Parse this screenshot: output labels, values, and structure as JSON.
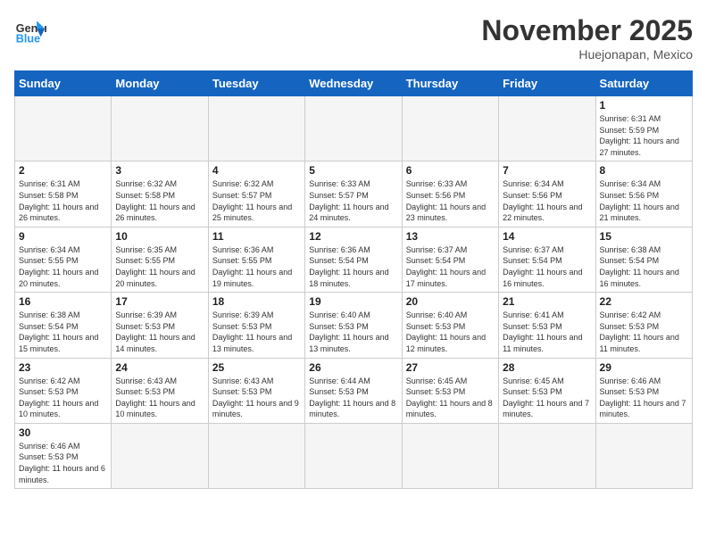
{
  "header": {
    "logo_general": "General",
    "logo_blue": "Blue",
    "month_title": "November 2025",
    "location": "Huejonapan, Mexico"
  },
  "weekdays": [
    "Sunday",
    "Monday",
    "Tuesday",
    "Wednesday",
    "Thursday",
    "Friday",
    "Saturday"
  ],
  "days": {
    "d1": {
      "num": "1",
      "sunrise": "Sunrise: 6:31 AM",
      "sunset": "Sunset: 5:59 PM",
      "daylight": "Daylight: 11 hours and 27 minutes."
    },
    "d2": {
      "num": "2",
      "sunrise": "Sunrise: 6:31 AM",
      "sunset": "Sunset: 5:58 PM",
      "daylight": "Daylight: 11 hours and 26 minutes."
    },
    "d3": {
      "num": "3",
      "sunrise": "Sunrise: 6:32 AM",
      "sunset": "Sunset: 5:58 PM",
      "daylight": "Daylight: 11 hours and 26 minutes."
    },
    "d4": {
      "num": "4",
      "sunrise": "Sunrise: 6:32 AM",
      "sunset": "Sunset: 5:57 PM",
      "daylight": "Daylight: 11 hours and 25 minutes."
    },
    "d5": {
      "num": "5",
      "sunrise": "Sunrise: 6:33 AM",
      "sunset": "Sunset: 5:57 PM",
      "daylight": "Daylight: 11 hours and 24 minutes."
    },
    "d6": {
      "num": "6",
      "sunrise": "Sunrise: 6:33 AM",
      "sunset": "Sunset: 5:56 PM",
      "daylight": "Daylight: 11 hours and 23 minutes."
    },
    "d7": {
      "num": "7",
      "sunrise": "Sunrise: 6:34 AM",
      "sunset": "Sunset: 5:56 PM",
      "daylight": "Daylight: 11 hours and 22 minutes."
    },
    "d8": {
      "num": "8",
      "sunrise": "Sunrise: 6:34 AM",
      "sunset": "Sunset: 5:56 PM",
      "daylight": "Daylight: 11 hours and 21 minutes."
    },
    "d9": {
      "num": "9",
      "sunrise": "Sunrise: 6:34 AM",
      "sunset": "Sunset: 5:55 PM",
      "daylight": "Daylight: 11 hours and 20 minutes."
    },
    "d10": {
      "num": "10",
      "sunrise": "Sunrise: 6:35 AM",
      "sunset": "Sunset: 5:55 PM",
      "daylight": "Daylight: 11 hours and 20 minutes."
    },
    "d11": {
      "num": "11",
      "sunrise": "Sunrise: 6:36 AM",
      "sunset": "Sunset: 5:55 PM",
      "daylight": "Daylight: 11 hours and 19 minutes."
    },
    "d12": {
      "num": "12",
      "sunrise": "Sunrise: 6:36 AM",
      "sunset": "Sunset: 5:54 PM",
      "daylight": "Daylight: 11 hours and 18 minutes."
    },
    "d13": {
      "num": "13",
      "sunrise": "Sunrise: 6:37 AM",
      "sunset": "Sunset: 5:54 PM",
      "daylight": "Daylight: 11 hours and 17 minutes."
    },
    "d14": {
      "num": "14",
      "sunrise": "Sunrise: 6:37 AM",
      "sunset": "Sunset: 5:54 PM",
      "daylight": "Daylight: 11 hours and 16 minutes."
    },
    "d15": {
      "num": "15",
      "sunrise": "Sunrise: 6:38 AM",
      "sunset": "Sunset: 5:54 PM",
      "daylight": "Daylight: 11 hours and 16 minutes."
    },
    "d16": {
      "num": "16",
      "sunrise": "Sunrise: 6:38 AM",
      "sunset": "Sunset: 5:54 PM",
      "daylight": "Daylight: 11 hours and 15 minutes."
    },
    "d17": {
      "num": "17",
      "sunrise": "Sunrise: 6:39 AM",
      "sunset": "Sunset: 5:53 PM",
      "daylight": "Daylight: 11 hours and 14 minutes."
    },
    "d18": {
      "num": "18",
      "sunrise": "Sunrise: 6:39 AM",
      "sunset": "Sunset: 5:53 PM",
      "daylight": "Daylight: 11 hours and 13 minutes."
    },
    "d19": {
      "num": "19",
      "sunrise": "Sunrise: 6:40 AM",
      "sunset": "Sunset: 5:53 PM",
      "daylight": "Daylight: 11 hours and 13 minutes."
    },
    "d20": {
      "num": "20",
      "sunrise": "Sunrise: 6:40 AM",
      "sunset": "Sunset: 5:53 PM",
      "daylight": "Daylight: 11 hours and 12 minutes."
    },
    "d21": {
      "num": "21",
      "sunrise": "Sunrise: 6:41 AM",
      "sunset": "Sunset: 5:53 PM",
      "daylight": "Daylight: 11 hours and 11 minutes."
    },
    "d22": {
      "num": "22",
      "sunrise": "Sunrise: 6:42 AM",
      "sunset": "Sunset: 5:53 PM",
      "daylight": "Daylight: 11 hours and 11 minutes."
    },
    "d23": {
      "num": "23",
      "sunrise": "Sunrise: 6:42 AM",
      "sunset": "Sunset: 5:53 PM",
      "daylight": "Daylight: 11 hours and 10 minutes."
    },
    "d24": {
      "num": "24",
      "sunrise": "Sunrise: 6:43 AM",
      "sunset": "Sunset: 5:53 PM",
      "daylight": "Daylight: 11 hours and 10 minutes."
    },
    "d25": {
      "num": "25",
      "sunrise": "Sunrise: 6:43 AM",
      "sunset": "Sunset: 5:53 PM",
      "daylight": "Daylight: 11 hours and 9 minutes."
    },
    "d26": {
      "num": "26",
      "sunrise": "Sunrise: 6:44 AM",
      "sunset": "Sunset: 5:53 PM",
      "daylight": "Daylight: 11 hours and 8 minutes."
    },
    "d27": {
      "num": "27",
      "sunrise": "Sunrise: 6:45 AM",
      "sunset": "Sunset: 5:53 PM",
      "daylight": "Daylight: 11 hours and 8 minutes."
    },
    "d28": {
      "num": "28",
      "sunrise": "Sunrise: 6:45 AM",
      "sunset": "Sunset: 5:53 PM",
      "daylight": "Daylight: 11 hours and 7 minutes."
    },
    "d29": {
      "num": "29",
      "sunrise": "Sunrise: 6:46 AM",
      "sunset": "Sunset: 5:53 PM",
      "daylight": "Daylight: 11 hours and 7 minutes."
    },
    "d30": {
      "num": "30",
      "sunrise": "Sunrise: 6:46 AM",
      "sunset": "Sunset: 5:53 PM",
      "daylight": "Daylight: 11 hours and 6 minutes."
    }
  }
}
